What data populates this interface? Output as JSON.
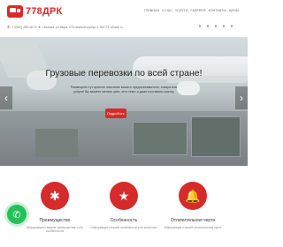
{
  "header": {
    "logo_text": "778ДРК",
    "nav": [
      "Главная",
      "О нас",
      "Услуги",
      "Галерея",
      "Контакты",
      "Цены"
    ],
    "phone_icon": "phone-icon",
    "phone": "+7(950) 285-48-76",
    "address_icon": "map-pin-icon",
    "address": "г.Москва, ул.Мира, 175 нежный корпус 4, 802 Р1 Штамп ы",
    "social": [
      "vk-icon",
      "facebook-icon",
      "instagram-icon",
      "twitter-icon",
      "youtube-icon"
    ]
  },
  "hero": {
    "title": "Грузовые перевозки по всей стране!",
    "text": "Размещено тут кратное описание вашего предпринимателя, товара или услуги! Вы можете менять цвет, этот текст и даже поставить ссылку",
    "button": "Подробнее",
    "prev_arrow": "‹",
    "next_arrow": "›"
  },
  "features": [
    {
      "icon": "asterisk-icon",
      "glyph": "✱",
      "title": "Преимущество",
      "desc": "Информация о вашем преимуществе и его особенностях"
    },
    {
      "icon": "star-icon",
      "glyph": "★",
      "title": "Особенность",
      "desc": "Информация о вашей особенности и ее качествах"
    },
    {
      "icon": "bell-icon",
      "glyph": "🔔",
      "title": "Отличительная черта",
      "desc": "Информация о вашей отличительной черте"
    }
  ],
  "colors": {
    "accent": "#d62b2b",
    "whatsapp": "#25c05a"
  }
}
